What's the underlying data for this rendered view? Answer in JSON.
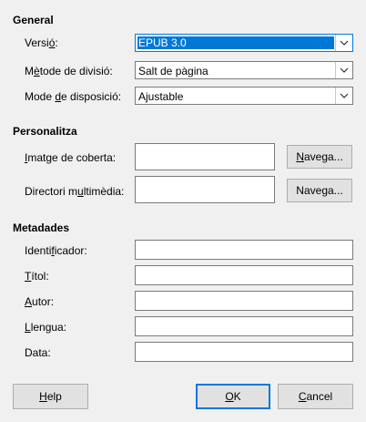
{
  "general": {
    "title": "General",
    "version": {
      "label_pre": "Versi",
      "label_u": "ó",
      "label_post": ":",
      "value": "EPUB 3.0"
    },
    "split": {
      "label_pre": "M",
      "label_u": "è",
      "label_post": "tode de divisió:",
      "value": "Salt de pàgina"
    },
    "layout": {
      "label_pre": "Mode ",
      "label_u": "d",
      "label_post": "e disposició:",
      "value": "Ajustable"
    }
  },
  "customize": {
    "title": "Personalitza",
    "cover": {
      "label_pre": "",
      "label_u": "I",
      "label_post": "matge de coberta:",
      "value": "",
      "browse_pre": "",
      "browse_u": "N",
      "browse_post": "avega..."
    },
    "media": {
      "label_pre": "Directori m",
      "label_u": "u",
      "label_post": "ltimèdia:",
      "value": "",
      "browse_pre": "Nave",
      "browse_u": "g",
      "browse_post": "a..."
    }
  },
  "metadata": {
    "title": "Metadades",
    "identifier": {
      "label_pre": "Identi",
      "label_u": "f",
      "label_post": "icador:",
      "value": ""
    },
    "title_field": {
      "label_pre": "",
      "label_u": "T",
      "label_post": "ítol:",
      "value": ""
    },
    "author": {
      "label_pre": "",
      "label_u": "A",
      "label_post": "utor:",
      "value": ""
    },
    "language": {
      "label_pre": "",
      "label_u": "L",
      "label_post": "lengua:",
      "value": ""
    },
    "date": {
      "label_pre": "Data:",
      "label_u": "",
      "label_post": "",
      "value": ""
    }
  },
  "footer": {
    "help_pre": "",
    "help_u": "H",
    "help_post": "elp",
    "ok_pre": "",
    "ok_u": "O",
    "ok_post": "K",
    "cancel_pre": "",
    "cancel_u": "C",
    "cancel_post": "ancel"
  },
  "colors": {
    "accent": "#0078d7",
    "background": "#f0f0f0"
  }
}
